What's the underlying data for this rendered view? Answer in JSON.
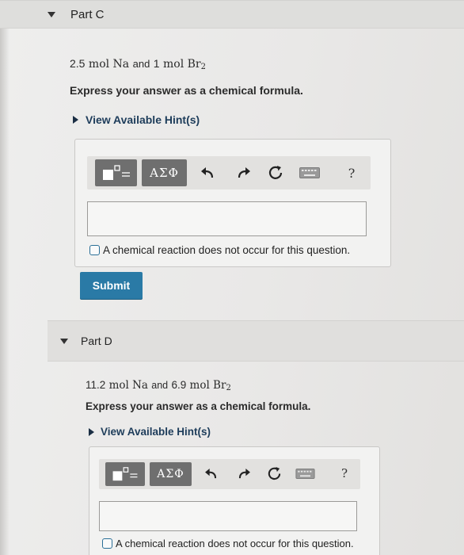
{
  "parts": [
    {
      "title": "Part C",
      "question": {
        "amount1": "2.5",
        "species1": "mol Na",
        "and": "and",
        "amount2": "1",
        "species2": "mol Br",
        "subscript": "2"
      },
      "instruction": "Express your answer as a chemical formula.",
      "hint_label": "View Available Hint(s)",
      "toolbar": {
        "greek_label": "ΑΣΦ",
        "help_label": "?"
      },
      "answer_value": "",
      "no_reaction_label": "A chemical reaction does not occur for this question.",
      "submit_label": "Submit"
    },
    {
      "title": "Part D",
      "question": {
        "amount1": "11.2",
        "species1": "mol Na",
        "and": "and",
        "amount2": "6.9",
        "species2": "mol Br",
        "subscript": "2"
      },
      "instruction": "Express your answer as a chemical formula.",
      "hint_label": "View Available Hint(s)",
      "toolbar": {
        "greek_label": "ΑΣΦ",
        "help_label": "?"
      },
      "answer_value": "",
      "no_reaction_label": "A chemical reaction does not occur for this question."
    }
  ],
  "icons": [
    "chevron-down-icon",
    "chevron-right-icon",
    "template-icon",
    "undo-icon",
    "redo-icon",
    "reset-icon",
    "keyboard-icon",
    "help-icon"
  ],
  "colors": {
    "submit_bg": "#2a7aa6",
    "hint_text": "#1d3c5a",
    "checkbox_border": "#2a6f97"
  }
}
